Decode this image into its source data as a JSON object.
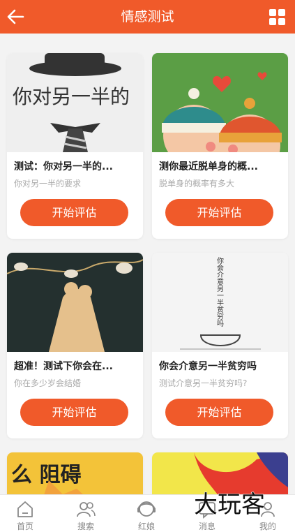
{
  "header": {
    "title": "情感测试"
  },
  "cards": [
    {
      "title": "测试：你对另一半的...",
      "subtitle": "你对另一半的要求",
      "button": "开始评估",
      "thumb_text": "你对另一半的"
    },
    {
      "title": "测你最近脱单身的概...",
      "subtitle": "脱单身的概率有多大",
      "button": "开始评估"
    },
    {
      "title": "超准！测试下你会在...",
      "subtitle": "你在多少岁会结婚",
      "button": "开始评估"
    },
    {
      "title": "你会介意另一半贫穷吗",
      "subtitle": "测试介意另一半贫穷吗?",
      "button": "开始评估",
      "thumb_text": "你会介意另一半贫穷吗"
    },
    {
      "thumb_text": "么 阻碍"
    },
    {}
  ],
  "nav": [
    {
      "label": "首页",
      "icon": "home-icon"
    },
    {
      "label": "搜索",
      "icon": "users-icon"
    },
    {
      "label": "红娘",
      "icon": "matchmaker-icon"
    },
    {
      "label": "消息",
      "icon": "message-icon"
    },
    {
      "label": "我的",
      "icon": "profile-icon"
    }
  ],
  "watermark": "大玩客",
  "colors": {
    "accent": "#f05a2a",
    "background": "#f3f3f3"
  }
}
